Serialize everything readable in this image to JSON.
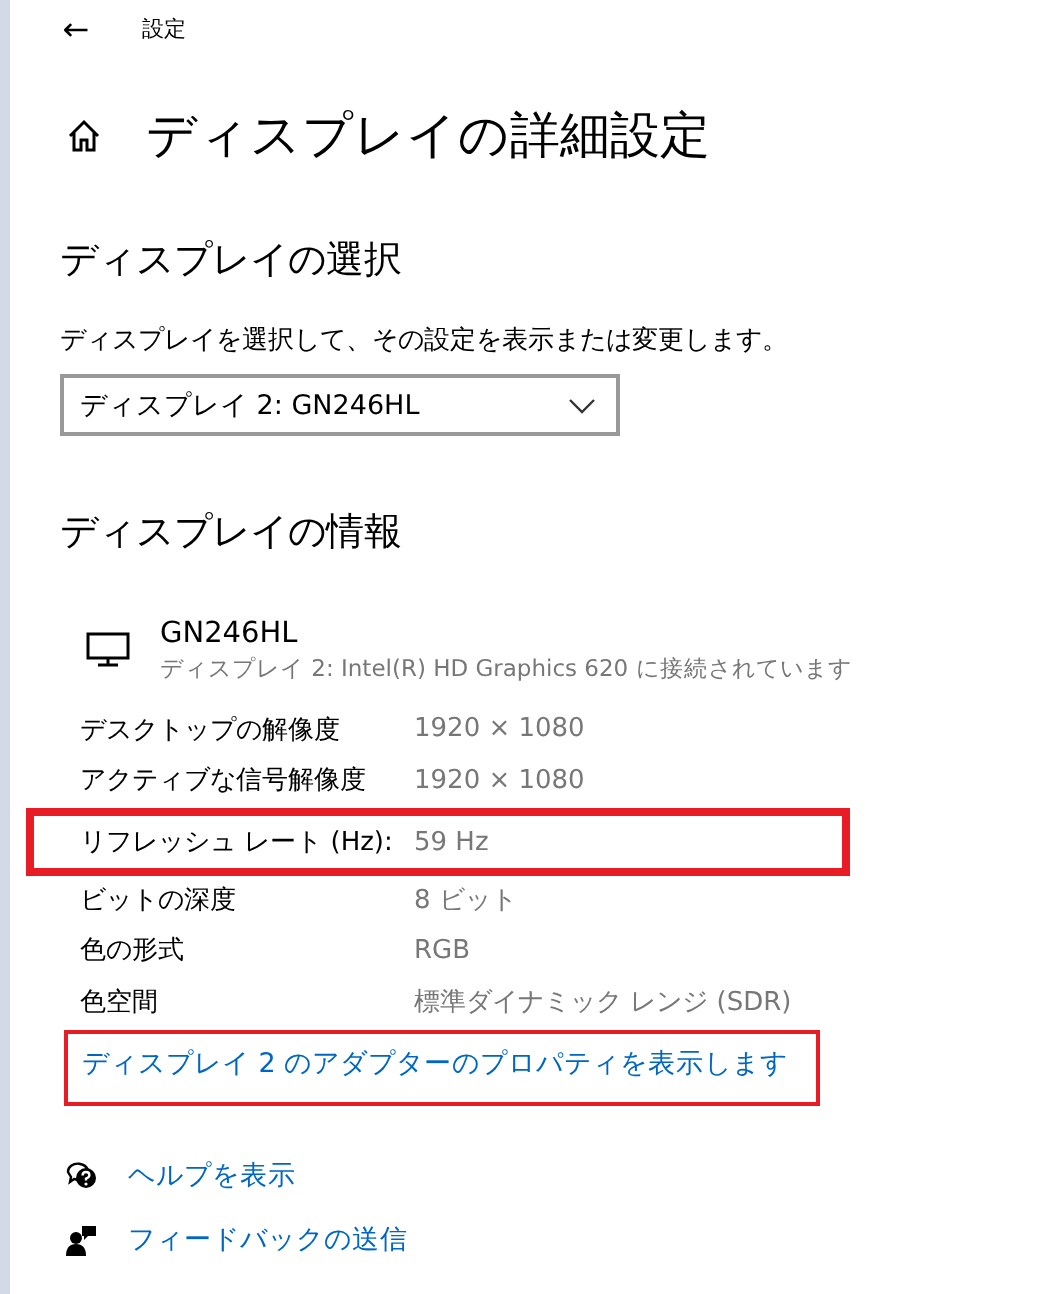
{
  "header": {
    "back": "←",
    "title": "設定"
  },
  "page_title": "ディスプレイの詳細設定",
  "select_section": {
    "heading": "ディスプレイの選択",
    "description": "ディスプレイを選択して、その設定を表示または変更します。",
    "dropdown": {
      "value": "ディスプレイ 2: GN246HL"
    }
  },
  "info_section": {
    "heading": "ディスプレイの情報",
    "monitor": {
      "name": "GN246HL",
      "connection": "ディスプレイ 2: Intel(R) HD Graphics 620 に接続されています"
    },
    "rows": [
      {
        "label": "デスクトップの解像度",
        "value": "1920 × 1080",
        "highlighted": false
      },
      {
        "label": "アクティブな信号解像度",
        "value": "1920 × 1080",
        "highlighted": false
      },
      {
        "label": "リフレッシュ レート (Hz):",
        "value": "59 Hz",
        "highlighted": true
      },
      {
        "label": "ビットの深度",
        "value": "8 ビット",
        "highlighted": false
      },
      {
        "label": "色の形式",
        "value": "RGB",
        "highlighted": false
      },
      {
        "label": "色空間",
        "value": "標準ダイナミック レンジ (SDR)",
        "highlighted": false
      }
    ],
    "adapter_link": {
      "text": "ディスプレイ 2 のアダプターのプロパティを表示します",
      "highlighted": true
    }
  },
  "footer_links": [
    {
      "kind": "help",
      "text": "ヘルプを表示"
    },
    {
      "kind": "feedback",
      "text": "フィードバックの送信"
    }
  ]
}
